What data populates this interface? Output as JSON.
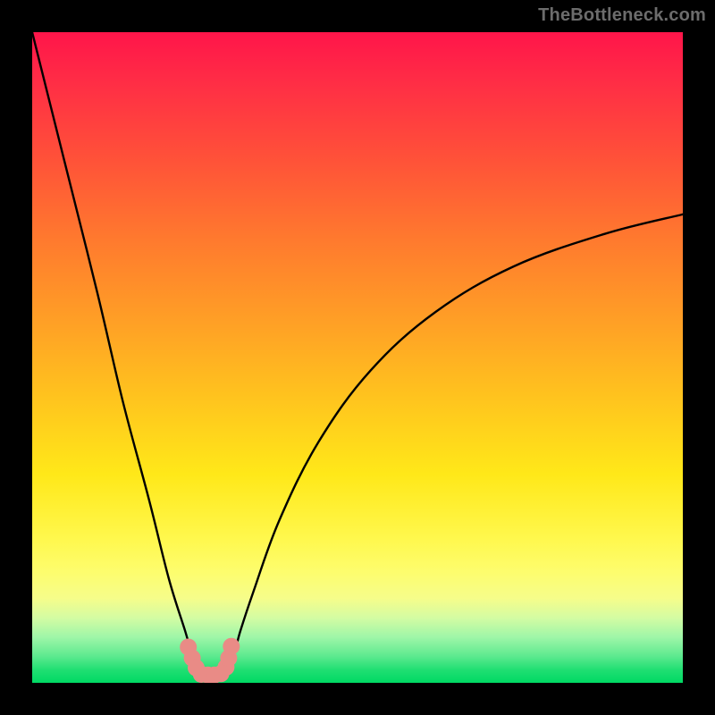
{
  "attribution": "TheBottleneck.com",
  "chart_data": {
    "type": "line",
    "title": "",
    "xlabel": "",
    "ylabel": "",
    "xlim": [
      0,
      100
    ],
    "ylim": [
      0,
      100
    ],
    "series": [
      {
        "name": "bottleneck-curve",
        "x": [
          0,
          5,
          10,
          14,
          18,
          21,
          23.5,
          25,
          26.5,
          28,
          30.5,
          32,
          34,
          38,
          44,
          52,
          62,
          74,
          88,
          100
        ],
        "y": [
          100,
          80,
          60,
          43,
          28,
          16,
          8,
          3,
          0.5,
          0.5,
          3,
          8,
          14,
          25,
          37,
          48,
          57,
          64,
          69,
          72
        ]
      }
    ],
    "markers": {
      "name": "optimum-band",
      "color": "#e98b86",
      "points": [
        {
          "x": 24.0,
          "y": 5.5
        },
        {
          "x": 24.6,
          "y": 3.8
        },
        {
          "x": 25.2,
          "y": 2.3
        },
        {
          "x": 26.0,
          "y": 1.3
        },
        {
          "x": 27.0,
          "y": 1.2
        },
        {
          "x": 28.0,
          "y": 1.2
        },
        {
          "x": 29.0,
          "y": 1.4
        },
        {
          "x": 29.8,
          "y": 2.4
        },
        {
          "x": 30.2,
          "y": 3.8
        },
        {
          "x": 30.6,
          "y": 5.6
        }
      ]
    },
    "background_gradient": {
      "top": "#ff154a",
      "bottom": "#00d964"
    }
  }
}
